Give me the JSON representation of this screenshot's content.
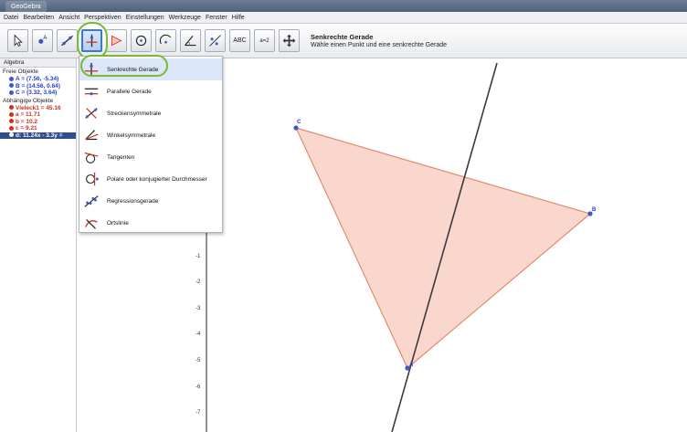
{
  "window": {
    "title": "GeoGebra"
  },
  "menu": [
    "Datei",
    "Bearbeiten",
    "Ansicht",
    "Perspektiven",
    "Einstellungen",
    "Werkzeuge",
    "Fenster",
    "Hilfe"
  ],
  "toolbar": {
    "tools": [
      {
        "name": "move",
        "icon": "arrow-pointer-icon"
      },
      {
        "name": "point",
        "icon": "point-icon"
      },
      {
        "name": "line",
        "icon": "line-icon"
      },
      {
        "name": "perpendicular",
        "icon": "perpendicular-line-icon",
        "active": true
      },
      {
        "name": "polygon",
        "icon": "polygon-icon"
      },
      {
        "name": "circle",
        "icon": "circle-icon"
      },
      {
        "name": "arc",
        "icon": "arc-icon"
      },
      {
        "name": "angle",
        "icon": "angle-icon"
      },
      {
        "name": "reflect",
        "icon": "reflect-icon"
      },
      {
        "name": "text",
        "icon": "text-icon",
        "label": "ABC"
      },
      {
        "name": "slider",
        "icon": "slider-icon",
        "label": "a=2"
      },
      {
        "name": "move-view",
        "icon": "move-view-icon"
      }
    ],
    "info_title": "Senkrechte Gerade",
    "info_text": "Wähle einen Punkt und eine senkrechte Gerade"
  },
  "algebra": {
    "header": "Algebra",
    "free_label": "Freie Objekte",
    "free": [
      "A = (7.56, -5.34)",
      "B = (14.56, 0.64)",
      "C = (3.32, 3.64)"
    ],
    "dependent_label": "Abhängige Objekte",
    "dependent": [
      "Vieleck1 = 45.16",
      "a = 11.71",
      "b = 10.2",
      "c = 9.21"
    ],
    "selected": "d: 11.24x - 3.3y ="
  },
  "dropdown": {
    "items": [
      {
        "label": "Senkrechte Gerade",
        "icon": "perpendicular-line-icon",
        "selected": true
      },
      {
        "label": "Parallele Gerade",
        "icon": "parallel-line-icon"
      },
      {
        "label": "Streckensymmetrale",
        "icon": "perpendicular-bisector-icon"
      },
      {
        "label": "Winkelsymmetrale",
        "icon": "angle-bisector-icon"
      },
      {
        "label": "Tangenten",
        "icon": "tangent-icon"
      },
      {
        "label": "Polare oder konjugierter Durchmesser",
        "icon": "polar-line-icon"
      },
      {
        "label": "Regressionsgerade",
        "icon": "regression-line-icon"
      },
      {
        "label": "Ortslinie",
        "icon": "locus-icon"
      }
    ]
  },
  "canvas": {
    "points": [
      {
        "label": "C"
      },
      {
        "label": "B"
      },
      {
        "label": "A"
      }
    ],
    "y_ticks": [
      "-1",
      "-2",
      "-3",
      "-4",
      "-5",
      "-6",
      "-7"
    ],
    "colors": {
      "triangle_fill": "#f7c6b8",
      "triangle_stroke": "#e38970",
      "line": "#3b3b3b",
      "point": "#3f58c9"
    }
  }
}
